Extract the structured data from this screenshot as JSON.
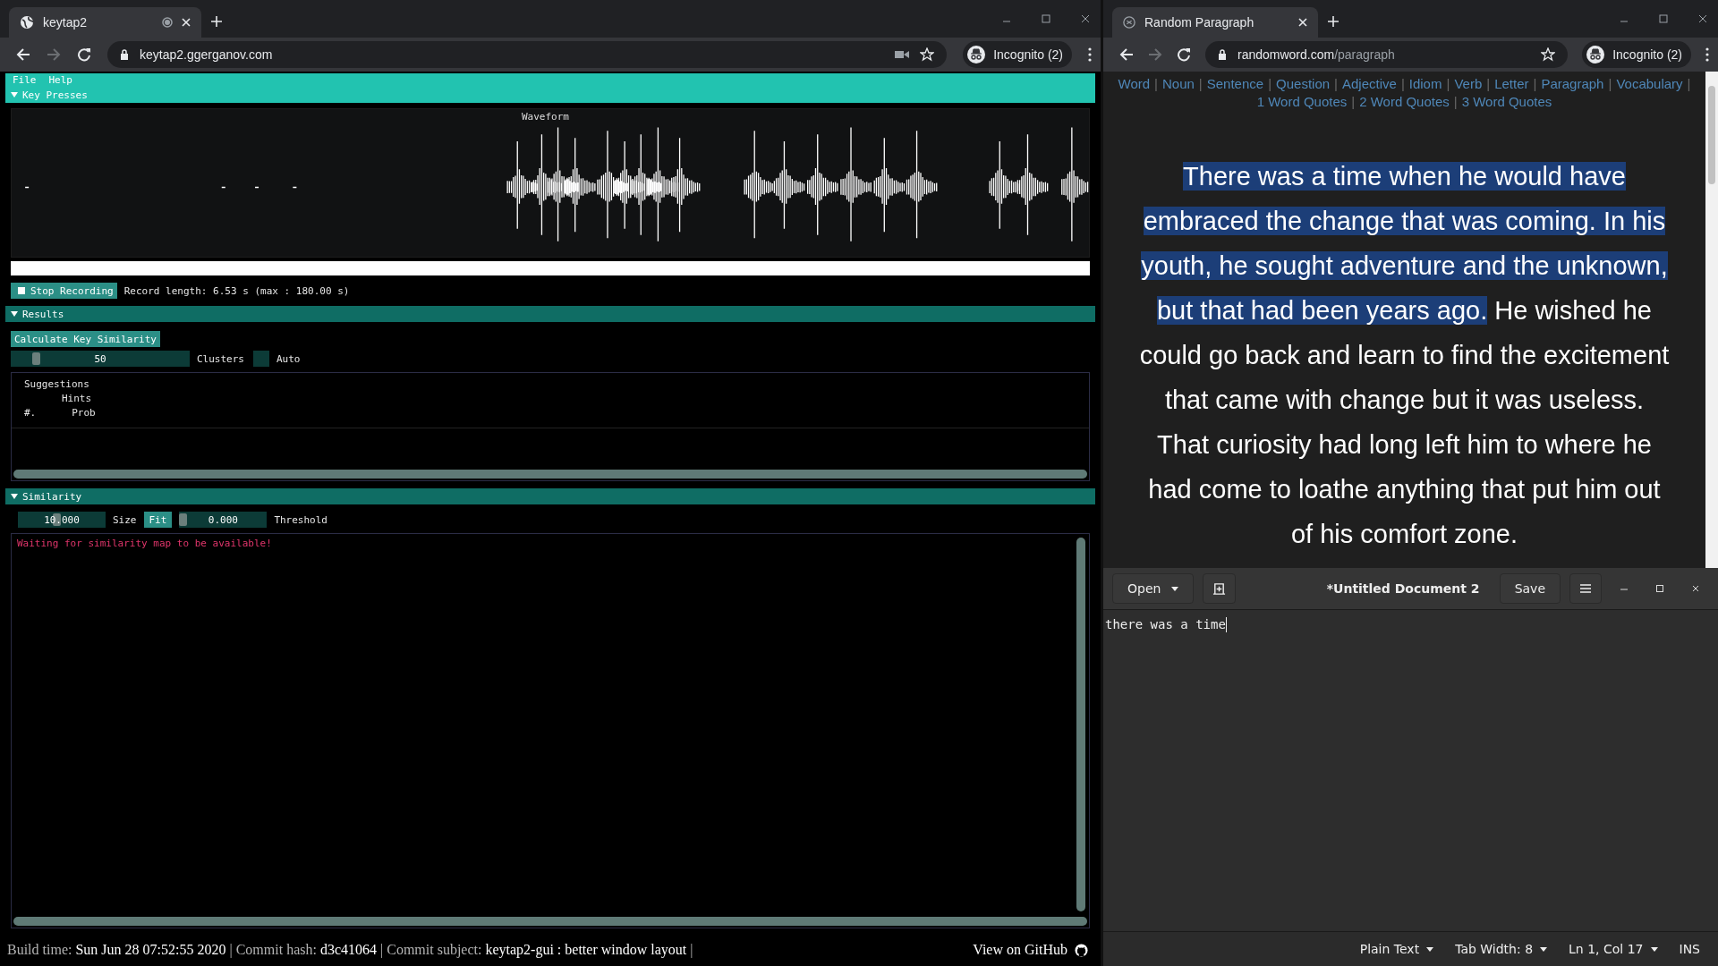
{
  "left_browser": {
    "tab_title": "keytap2",
    "url": "keytap2.ggerganov.com",
    "profile": "Incognito (2)"
  },
  "app": {
    "menu": [
      "File",
      "Help"
    ],
    "key_presses": {
      "header": "Key Presses",
      "expanded": true,
      "progress": {
        "level": 1
      },
      "waveform_title": "Waveform",
      "record_button": "Stop Recording",
      "record_length": "Record length: 6.53 s (max : 180.00 s)"
    },
    "results": {
      "header": "Results",
      "expanded": true,
      "calculate_button": "Calculate Key Similarity",
      "clusters": {
        "value": "50",
        "level": 0.12,
        "label": "Clusters"
      },
      "auto": {
        "label": "Auto",
        "checked": false
      },
      "table_lines": [
        "Suggestions",
        "Hints"
      ],
      "columns": [
        "#.",
        "Prob"
      ]
    },
    "similarity": {
      "header": "Similarity",
      "expanded": true,
      "size": {
        "value": "10.000",
        "level": 0.4,
        "label": "Size"
      },
      "fit_button": "Fit",
      "threshold": {
        "value": "0.000",
        "level": 0,
        "label": "Threshold"
      },
      "message": "Waiting for similarity map to be available!"
    }
  },
  "footer": {
    "separator": "|",
    "items": [
      {
        "label": "Build time:",
        "value": "Sun Jun 28 07:52:55 2020"
      },
      {
        "label": "Commit hash:",
        "value": "d3c41064"
      },
      {
        "label": "Commit subject:",
        "value": "keytap2-gui : better window layout"
      }
    ],
    "github_link": "View on GitHub"
  },
  "right_browser": {
    "tab_title": "Random Paragraph",
    "url_host": "randomword.com",
    "url_path": "/paragraph",
    "profile": "Incognito (2)",
    "nav_separator": "|",
    "nav_links": [
      "Word",
      "Noun",
      "Sentence",
      "Question",
      "Adjective",
      "Idiom",
      "Verb",
      "Letter",
      "Paragraph",
      "Vocabulary",
      "1 Word Quotes",
      "2 Word Quotes",
      "3 Word Quotes"
    ],
    "paragraph": {
      "selected_text": "There was a time when he would have embraced the change that was coming. In his youth, he sought adventure and the unknown, but that had been years ago.",
      "text": "He wished he could go back and learn to find the excitement that came with change but it was useless. That curiosity had long left him to where he had come to loathe anything that put him out of his comfort zone."
    }
  },
  "editor": {
    "open_button": "Open",
    "title": "*Untitled Document 2",
    "save_button": "Save",
    "content": "there was a time",
    "status_bar": [
      {
        "label": "Plain Text",
        "dropdown": true
      },
      {
        "label": "Tab Width: 8",
        "dropdown": true
      },
      {
        "label": "Ln 1, Col 17",
        "dropdown": true
      },
      {
        "label": "INS",
        "dropdown": false
      }
    ]
  }
}
